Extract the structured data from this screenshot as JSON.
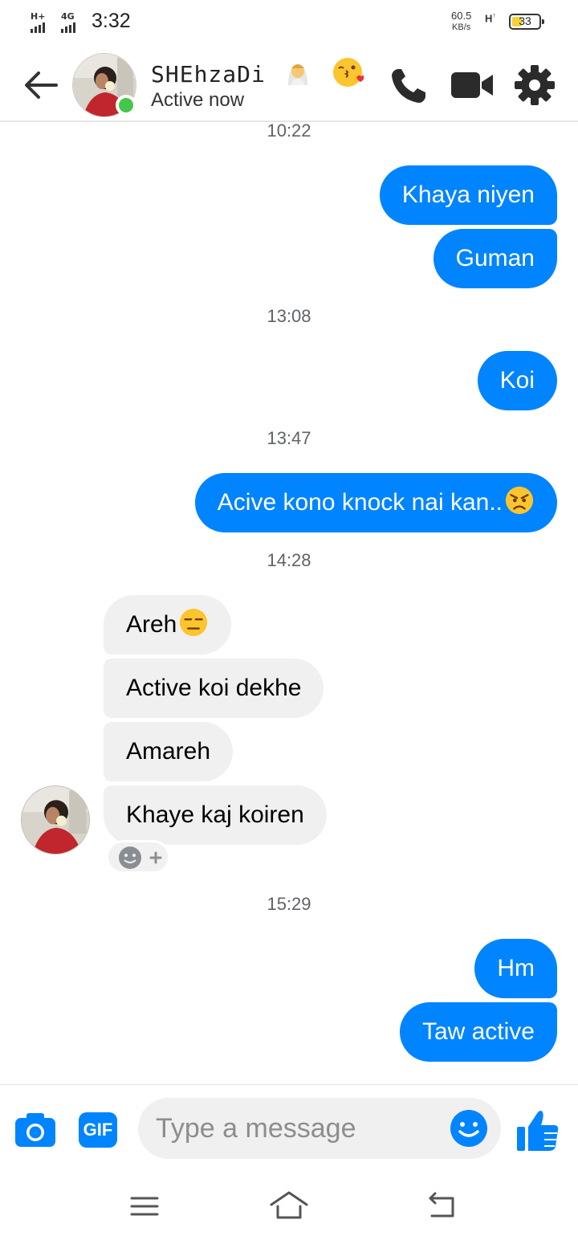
{
  "status_bar": {
    "net1": "H+",
    "net2": "4G",
    "time": "3:32",
    "speed_value": "60.5",
    "speed_unit": "KB/s",
    "net3": "H",
    "battery": "33"
  },
  "header": {
    "contact_name": "SHEhzaDi",
    "status": "Active now"
  },
  "messages": [
    {
      "type": "timestamp",
      "text": "10:22"
    },
    {
      "type": "out",
      "text": "Khaya niyen"
    },
    {
      "type": "out",
      "text": "Guman"
    },
    {
      "type": "timestamp",
      "text": "13:08"
    },
    {
      "type": "out",
      "text": "Koi"
    },
    {
      "type": "timestamp",
      "text": "13:47"
    },
    {
      "type": "out",
      "text": "Acive kono knock nai kan..",
      "emoji": "angry-face"
    },
    {
      "type": "timestamp",
      "text": "14:28"
    },
    {
      "type": "in",
      "text": "Areh",
      "emoji": "expressionless-face"
    },
    {
      "type": "in",
      "text": "Active koi dekhe"
    },
    {
      "type": "in",
      "text": "Amareh"
    },
    {
      "type": "in",
      "text": "Khaye kaj koiren"
    },
    {
      "type": "timestamp",
      "text": "15:29"
    },
    {
      "type": "out",
      "text": "Hm"
    },
    {
      "type": "out",
      "text": "Taw active"
    }
  ],
  "composer": {
    "gif_label": "GIF",
    "placeholder": "Type a message"
  },
  "colors": {
    "accent": "#0084ff",
    "incoming_bubble": "#f1f0f0",
    "online": "#44c74a"
  }
}
